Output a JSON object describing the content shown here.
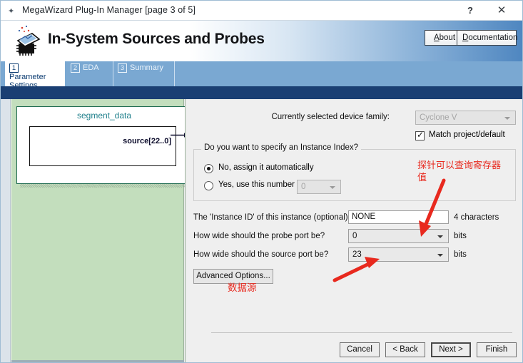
{
  "titlebar": {
    "icon": "wizard-wand-icon",
    "title": "MegaWizard Plug-In Manager [page 3 of 5]",
    "help": "?",
    "close": "✕"
  },
  "banner": {
    "logo": "chip-wizard-icon",
    "title": "In-System Sources and Probes",
    "about_label": "About",
    "about_mnemonic": "A",
    "about_rest": "bout",
    "doc_label": "Documentation",
    "doc_mnemonic": "D",
    "doc_rest": "ocumentation"
  },
  "tabs": [
    {
      "number": "1",
      "label": "Parameter Settings",
      "active": true
    },
    {
      "number": "2",
      "label": "EDA",
      "active": false
    },
    {
      "number": "3",
      "label": "Summary",
      "active": false
    }
  ],
  "preview": {
    "symbol_name": "segment_data",
    "port_label": "source[22..0]"
  },
  "settings": {
    "device_family_label": "Currently selected device family:",
    "device_family_value": "Cyclone V",
    "device_family_disabled": true,
    "match_checkbox_label": "Match project/default",
    "match_checkbox_checked": true,
    "match_tick": "✓",
    "instance_group_title": "Do you want to specify an Instance Index?",
    "radio_auto_label": "No, assign it automatically",
    "radio_auto_selected": true,
    "radio_number_label": "Yes, use this number",
    "radio_number_value": "0",
    "radio_number_selected": false,
    "instance_id_label": "The 'Instance ID' of this instance (optional):",
    "instance_id_value": "NONE",
    "instance_id_hint": "4 characters",
    "probe_width_label": "How wide should the probe port be?",
    "probe_width_value": "0",
    "probe_width_units": "bits",
    "source_width_label": "How wide should the source port be?",
    "source_width_value": "23",
    "source_width_units": "bits",
    "advanced_options_label": "Advanced Options..."
  },
  "footer": {
    "cancel": "Cancel",
    "back": "< Back",
    "next": "Next >",
    "finish": "Finish"
  },
  "annotations": [
    {
      "text": "探针可以查询寄存器\n值",
      "color": "#e8291e"
    },
    {
      "text": "数据源",
      "color": "#e8291e"
    }
  ],
  "colors": {
    "accent_blue": "#1a3f73",
    "tab_strip": "#7aa8d2",
    "preview_green": "#c3debd",
    "symbol_border": "#1d6a4f",
    "symbol_name": "#20808c",
    "annotation_red": "#e8291e"
  }
}
